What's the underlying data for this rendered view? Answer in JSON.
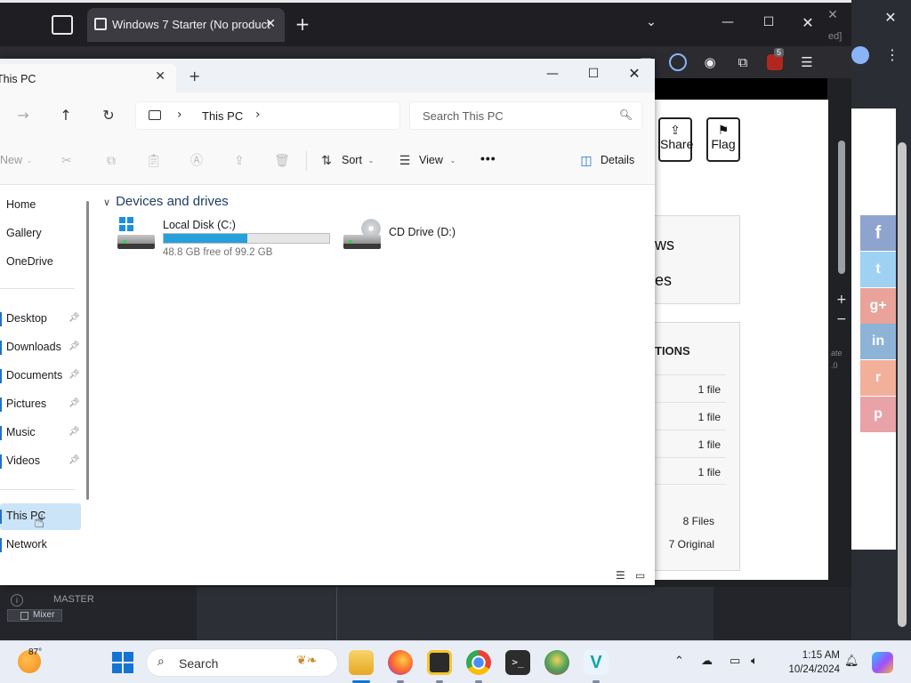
{
  "browser": {
    "tab_title": "Windows 7 Starter (No product",
    "right_partial_text": "ed]",
    "menu_badge": "5",
    "page": {
      "share_label": "Share",
      "flag_label": "Flag",
      "panel_text_1": "ws",
      "panel_text_2": "es",
      "section_title": "TIONS",
      "file_rows": [
        "1 file",
        "1 file",
        "1 file",
        "1 file"
      ],
      "summary_files": "8 Files",
      "summary_original": "7 Original"
    },
    "side_text": [
      "ate",
      ".0"
    ],
    "social": [
      "f",
      "t",
      "g+",
      "in",
      "r",
      "p"
    ]
  },
  "daw": {
    "master_label": "MASTER",
    "mixer_label": "Mixer"
  },
  "explorer": {
    "tab_title": "This PC",
    "address": {
      "crumb": "This PC"
    },
    "search": {
      "placeholder": "Search This PC"
    },
    "commands": {
      "new_label": "New",
      "sort_label": "Sort",
      "view_label": "View",
      "more_label": "•••",
      "details_label": "Details"
    },
    "nav": {
      "items": [
        {
          "label": "Home",
          "pinned": false
        },
        {
          "label": "Gallery",
          "pinned": false
        },
        {
          "label": "OneDrive",
          "pinned": false
        },
        {
          "label": "Desktop",
          "pinned": true
        },
        {
          "label": "Downloads",
          "pinned": true
        },
        {
          "label": "Documents",
          "pinned": true
        },
        {
          "label": "Pictures",
          "pinned": true
        },
        {
          "label": "Music",
          "pinned": true
        },
        {
          "label": "Videos",
          "pinned": true
        },
        {
          "label": "This PC",
          "pinned": false,
          "selected": true
        },
        {
          "label": "Network",
          "pinned": false
        }
      ],
      "partial_bottom": "s"
    },
    "group_title": "Devices and drives",
    "drives": [
      {
        "name": "Local Disk (C:)",
        "free_text": "48.8 GB free of 99.2 GB",
        "used_fraction": 0.508
      },
      {
        "name": "CD Drive (D:)"
      }
    ]
  },
  "taskbar": {
    "weather_temp": "87°",
    "search_label": "Search",
    "time": "1:15 AM",
    "date": "10/24/2024"
  },
  "colors": {
    "accent": "#1f73c8",
    "progress": "#26a0da",
    "selection": "#cce4f7"
  }
}
